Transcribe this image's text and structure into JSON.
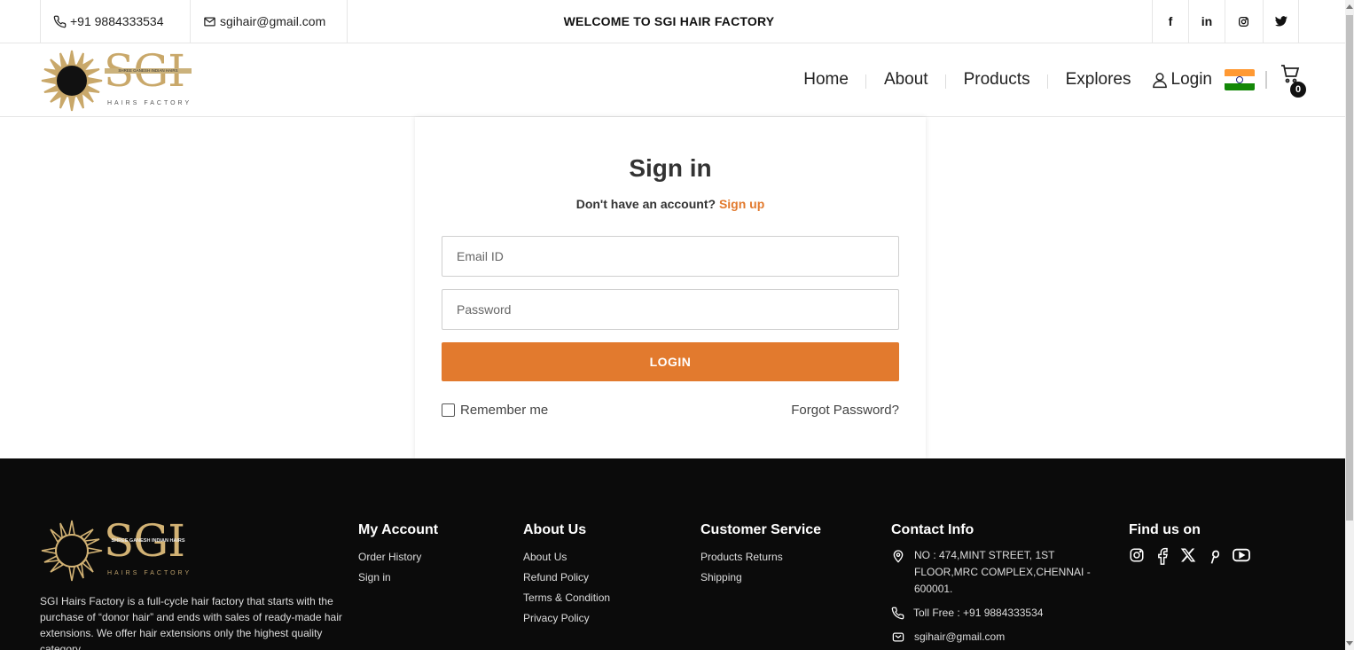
{
  "topbar": {
    "phone": "+91 9884333534",
    "email": "sgihair@gmail.com",
    "welcome": "WELCOME TO SGI HAIR FACTORY",
    "social": [
      {
        "icon": "facebook-icon",
        "glyph": "f"
      },
      {
        "icon": "linkedin-icon",
        "glyph": "in"
      },
      {
        "icon": "instagram-icon",
        "glyph": ""
      },
      {
        "icon": "twitter-icon",
        "glyph": ""
      }
    ]
  },
  "header": {
    "logo": {
      "text": "SGI",
      "band": "SHREE GANESH INDIAN HAIRS",
      "sub": "HAIRS FACTORY"
    },
    "nav": [
      "Home",
      "About",
      "Products",
      "Explores"
    ],
    "login_label": "Login",
    "flag": {
      "saffron": "#ff9933",
      "white": "#ffffff",
      "green": "#138808"
    },
    "cart_count": "0"
  },
  "login": {
    "title": "Sign in",
    "prompt": "Don't have an account?",
    "signup_label": "Sign up",
    "email_placeholder": "Email ID",
    "password_placeholder": "Password",
    "button_label": "LOGIN",
    "remember_label": "Remember me",
    "forgot_label": "Forgot Password?"
  },
  "footer": {
    "logo": {
      "text": "SGI",
      "band": "SHREE GANESH INDIAN HAIRS",
      "sub": "HAIRS FACTORY"
    },
    "description": "SGI Hairs Factory is a full-cycle hair factory that starts with the purchase of “donor hair” and ends with sales of ready-made hair extensions. We offer hair extensions only the highest quality category.",
    "my_account": {
      "title": "My Account",
      "links": [
        "Order History",
        "Sign in"
      ]
    },
    "about_us": {
      "title": "About Us",
      "links": [
        "About Us",
        "Refund Policy",
        "Terms & Condition",
        "Privacy Policy"
      ]
    },
    "customer_service": {
      "title": "Customer Service",
      "links": [
        "Products Returns",
        "Shipping"
      ]
    },
    "contact": {
      "title": "Contact Info",
      "address": "NO : 474,MINT STREET, 1ST FLOOR,MRC COMPLEX,CHENNAI - 600001.",
      "toll_free": "Toll Free : +91 9884333534",
      "email": "sgihair@gmail.com"
    },
    "find_us": {
      "title": "Find us on"
    }
  },
  "colors": {
    "accent": "#e27a2e",
    "footer_bg": "#0b0b0b",
    "logo_gold": "#c9a86a"
  }
}
